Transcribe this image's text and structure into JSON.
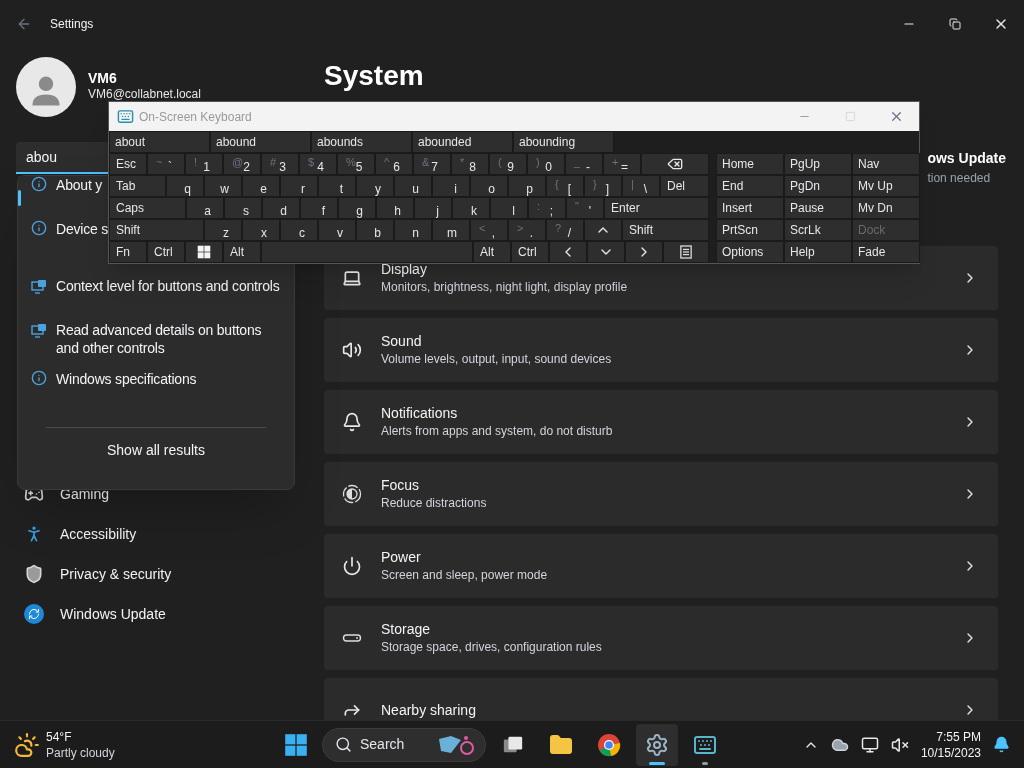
{
  "window": {
    "title": "Settings"
  },
  "profile": {
    "name": "VM6",
    "email": "VM6@collabnet.local"
  },
  "search": {
    "value": "abou"
  },
  "search_results": [
    {
      "text": "About y",
      "kind": "info",
      "selected": true
    },
    {
      "text": "Device s",
      "kind": "info",
      "selected": false
    },
    {
      "text": "Context level for buttons and controls",
      "kind": "narrator",
      "selected": false
    },
    {
      "text": "Read advanced details on buttons and other controls",
      "kind": "narrator",
      "selected": false
    },
    {
      "text": "Windows specifications",
      "kind": "info",
      "selected": false
    }
  ],
  "show_all": "Show all results",
  "sidebar": {
    "items": [
      {
        "label": "Gaming"
      },
      {
        "label": "Accessibility"
      },
      {
        "label": "Privacy & security"
      },
      {
        "label": "Windows Update"
      }
    ]
  },
  "page": {
    "title": "System",
    "update_tile": {
      "title": "ows Update",
      "subtitle": "tion needed"
    },
    "cards": [
      {
        "title": "Display",
        "subtitle": "Monitors, brightness, night light, display profile"
      },
      {
        "title": "Sound",
        "subtitle": "Volume levels, output, input, sound devices"
      },
      {
        "title": "Notifications",
        "subtitle": "Alerts from apps and system, do not disturb"
      },
      {
        "title": "Focus",
        "subtitle": "Reduce distractions"
      },
      {
        "title": "Power",
        "subtitle": "Screen and sleep, power mode"
      },
      {
        "title": "Storage",
        "subtitle": "Storage space, drives, configuration rules"
      },
      {
        "title": "Nearby sharing"
      }
    ]
  },
  "keyboard": {
    "title": "On-Screen Keyboard",
    "suggestions": [
      "about",
      "abound",
      "abounds",
      "abounded",
      "abounding"
    ],
    "rows": [
      [
        {
          "kind": "esc",
          "label": "Esc"
        },
        {
          "kind": "char",
          "label": "`",
          "shift": "~"
        },
        {
          "kind": "char",
          "label": "1",
          "shift": "!"
        },
        {
          "kind": "char",
          "label": "2",
          "shift": "@"
        },
        {
          "kind": "char",
          "label": "3",
          "shift": "#"
        },
        {
          "kind": "char",
          "label": "4",
          "shift": "$"
        },
        {
          "kind": "char",
          "label": "5",
          "shift": "%"
        },
        {
          "kind": "char",
          "label": "6",
          "shift": "^"
        },
        {
          "kind": "char",
          "label": "7",
          "shift": "&"
        },
        {
          "kind": "char",
          "label": "8",
          "shift": "*"
        },
        {
          "kind": "char",
          "label": "9",
          "shift": "("
        },
        {
          "kind": "char",
          "label": "0",
          "shift": ")"
        },
        {
          "kind": "char",
          "label": "-",
          "shift": "_"
        },
        {
          "kind": "char",
          "label": "=",
          "shift": "+"
        },
        {
          "kind": "backspace"
        }
      ],
      [
        {
          "kind": "tab",
          "label": "Tab"
        },
        {
          "kind": "char",
          "label": "q"
        },
        {
          "kind": "char",
          "label": "w"
        },
        {
          "kind": "char",
          "label": "e"
        },
        {
          "kind": "char",
          "label": "r"
        },
        {
          "kind": "char",
          "label": "t"
        },
        {
          "kind": "char",
          "label": "y"
        },
        {
          "kind": "char",
          "label": "u"
        },
        {
          "kind": "char",
          "label": "i"
        },
        {
          "kind": "char",
          "label": "o"
        },
        {
          "kind": "char",
          "label": "p"
        },
        {
          "kind": "char",
          "label": "[",
          "shift": "{"
        },
        {
          "kind": "char",
          "label": "]",
          "shift": "}"
        },
        {
          "kind": "char",
          "label": "\\",
          "shift": "|"
        },
        {
          "kind": "del",
          "label": "Del"
        }
      ],
      [
        {
          "kind": "caps",
          "label": "Caps"
        },
        {
          "kind": "char",
          "label": "a"
        },
        {
          "kind": "char",
          "label": "s"
        },
        {
          "kind": "char",
          "label": "d"
        },
        {
          "kind": "char",
          "label": "f"
        },
        {
          "kind": "char",
          "label": "g"
        },
        {
          "kind": "char",
          "label": "h"
        },
        {
          "kind": "char",
          "label": "j"
        },
        {
          "kind": "char",
          "label": "k"
        },
        {
          "kind": "char",
          "label": "l"
        },
        {
          "kind": "char",
          "label": ";",
          "shift": ":"
        },
        {
          "kind": "char",
          "label": "'",
          "shift": "\""
        },
        {
          "kind": "enter",
          "label": "Enter"
        }
      ],
      [
        {
          "kind": "shift",
          "label": "Shift"
        },
        {
          "kind": "char",
          "label": "z"
        },
        {
          "kind": "char",
          "label": "x"
        },
        {
          "kind": "char",
          "label": "c"
        },
        {
          "kind": "char",
          "label": "v"
        },
        {
          "kind": "char",
          "label": "b"
        },
        {
          "kind": "char",
          "label": "n"
        },
        {
          "kind": "char",
          "label": "m"
        },
        {
          "kind": "char",
          "label": ",",
          "shift": "<"
        },
        {
          "kind": "char",
          "label": ".",
          "shift": ">"
        },
        {
          "kind": "char",
          "label": "/",
          "shift": "?"
        },
        {
          "kind": "arrow-up"
        },
        {
          "kind": "rshift",
          "label": "Shift"
        }
      ],
      [
        {
          "kind": "fn",
          "label": "Fn"
        },
        {
          "kind": "ctrl",
          "label": "Ctrl"
        },
        {
          "kind": "windows"
        },
        {
          "kind": "alt",
          "label": "Alt"
        },
        {
          "kind": "space"
        },
        {
          "kind": "alt",
          "label": "Alt"
        },
        {
          "kind": "ctrl",
          "label": "Ctrl"
        },
        {
          "kind": "arrow-left"
        },
        {
          "kind": "arrow-down"
        },
        {
          "kind": "arrow-right"
        },
        {
          "kind": "menu"
        }
      ]
    ],
    "nav_rows": [
      [
        {
          "label": "Home",
          "disabled": false
        },
        {
          "label": "PgUp",
          "disabled": false
        },
        {
          "label": "Nav",
          "disabled": false
        }
      ],
      [
        {
          "label": "End",
          "disabled": false
        },
        {
          "label": "PgDn",
          "disabled": false
        },
        {
          "label": "Mv Up",
          "disabled": false
        }
      ],
      [
        {
          "label": "Insert",
          "disabled": false
        },
        {
          "label": "Pause",
          "disabled": false
        },
        {
          "label": "Mv Dn",
          "disabled": false
        }
      ],
      [
        {
          "label": "PrtScn",
          "disabled": false
        },
        {
          "label": "ScrLk",
          "disabled": false
        },
        {
          "label": "Dock",
          "disabled": true
        }
      ],
      [
        {
          "label": "Options",
          "disabled": false
        },
        {
          "label": "Help",
          "disabled": false
        },
        {
          "label": "Fade",
          "disabled": false
        }
      ]
    ]
  },
  "taskbar": {
    "weather": {
      "temp": "54°F",
      "condition": "Partly cloudy"
    },
    "search_label": "Search",
    "apps": [
      {
        "selected": false,
        "running": false
      },
      {
        "selected": false,
        "running": false
      },
      {
        "selected": false,
        "running": false
      },
      {
        "selected": true,
        "running": true
      },
      {
        "selected": false,
        "running": true
      }
    ],
    "clock": {
      "time": "7:55 PM",
      "date": "10/15/2023"
    }
  }
}
